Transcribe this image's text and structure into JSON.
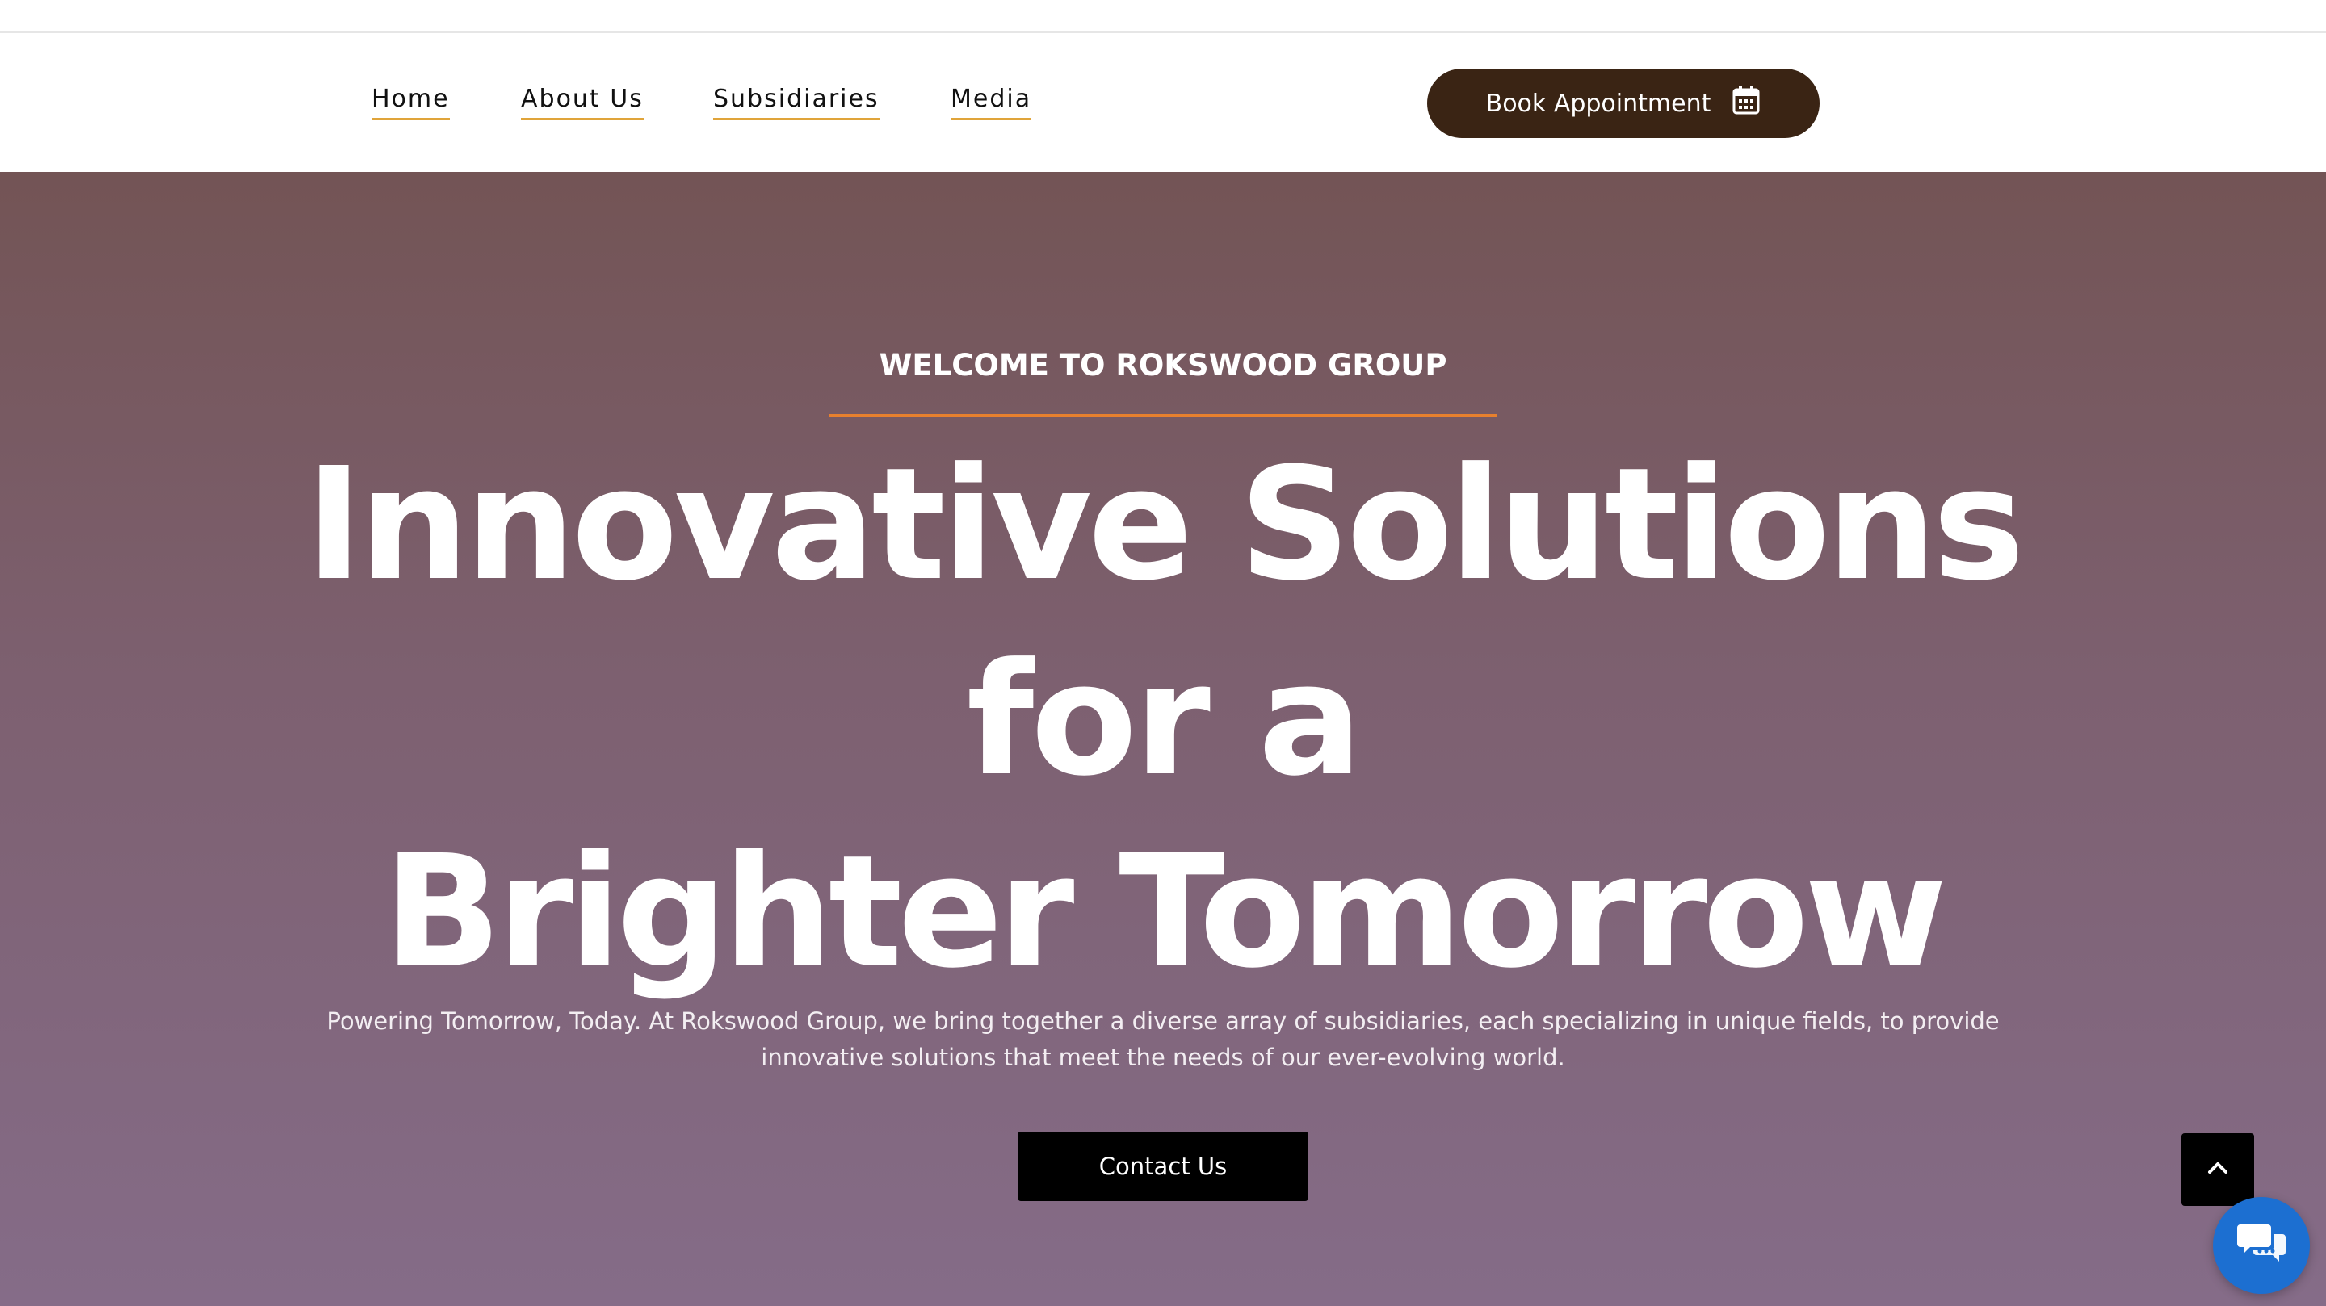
{
  "nav": {
    "links": [
      {
        "label": "Home"
      },
      {
        "label": "About Us"
      },
      {
        "label": "Subsidiaries"
      },
      {
        "label": "Media"
      }
    ],
    "book_button": {
      "label": "Book Appointment",
      "icon": "calendar-icon"
    }
  },
  "hero": {
    "eyebrow": "WELCOME TO ROKSWOOD GROUP",
    "headline_line1": "Innovative Solutions",
    "headline_line2": "for a",
    "headline_line3": "Brighter Tomorrow",
    "subtext": "Powering Tomorrow, Today. At Rokswood Group, we bring together a diverse array of subsidiaries, each specializing in unique fields, to provide innovative solutions that meet the needs of our ever-evolving world.",
    "contact_button": "Contact Us"
  },
  "widgets": {
    "scroll_top_icon": "chevron-up-icon",
    "chat_icon": "chat-bubbles-icon"
  },
  "colors": {
    "accent_underline": "#e0a43a",
    "eyebrow_line": "#e7802e",
    "book_button_bg": "#3a2414",
    "chat_button_bg": "#1c6fd1"
  }
}
